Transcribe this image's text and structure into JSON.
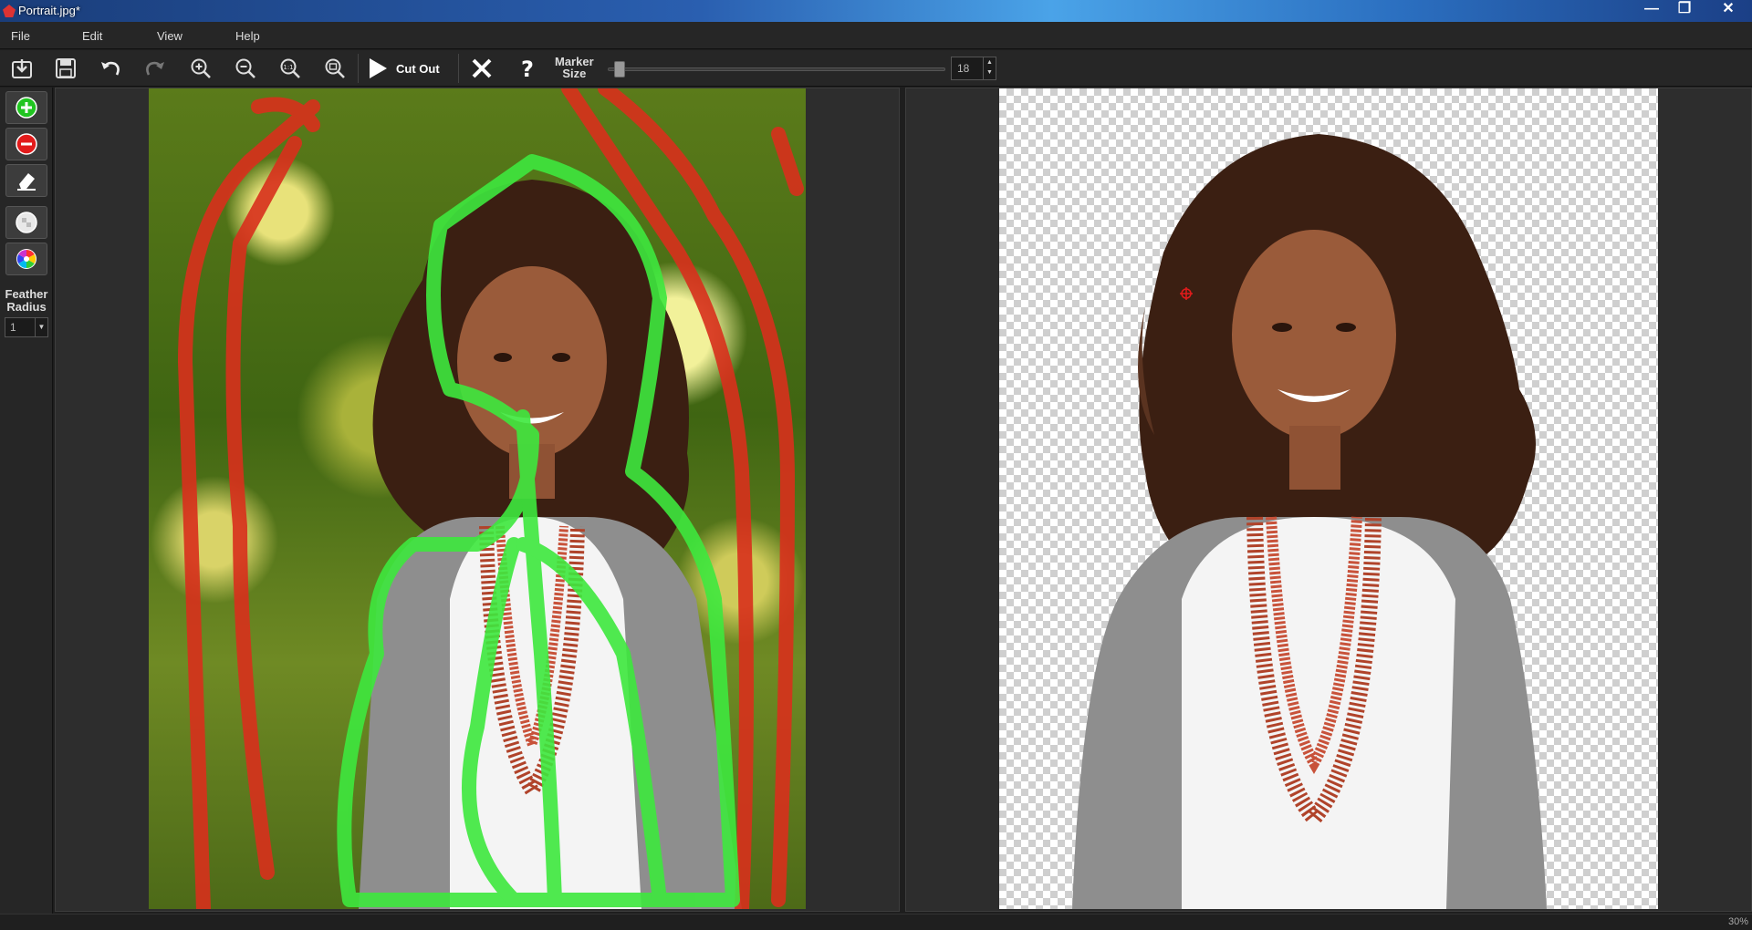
{
  "window": {
    "title": "Portrait.jpg*",
    "minimize": "—",
    "restore": "❐",
    "close": "✕"
  },
  "menu": [
    "File",
    "Edit",
    "View",
    "Help"
  ],
  "toolbar": {
    "cut_out_label": "Cut Out",
    "marker_size_label_1": "Marker",
    "marker_size_label_2": "Size",
    "marker_size_value": "18",
    "marker_size_level": 0.02
  },
  "left_panel": {
    "feather_label_1": "Feather",
    "feather_label_2": "Radius",
    "feather_value": "1"
  },
  "status": {
    "zoom": "30%"
  },
  "colors": {
    "keep_marker": "#3ee83e",
    "remove_marker": "#d8301c",
    "accent_green": "#21c521",
    "accent_red": "#e21b1b"
  }
}
